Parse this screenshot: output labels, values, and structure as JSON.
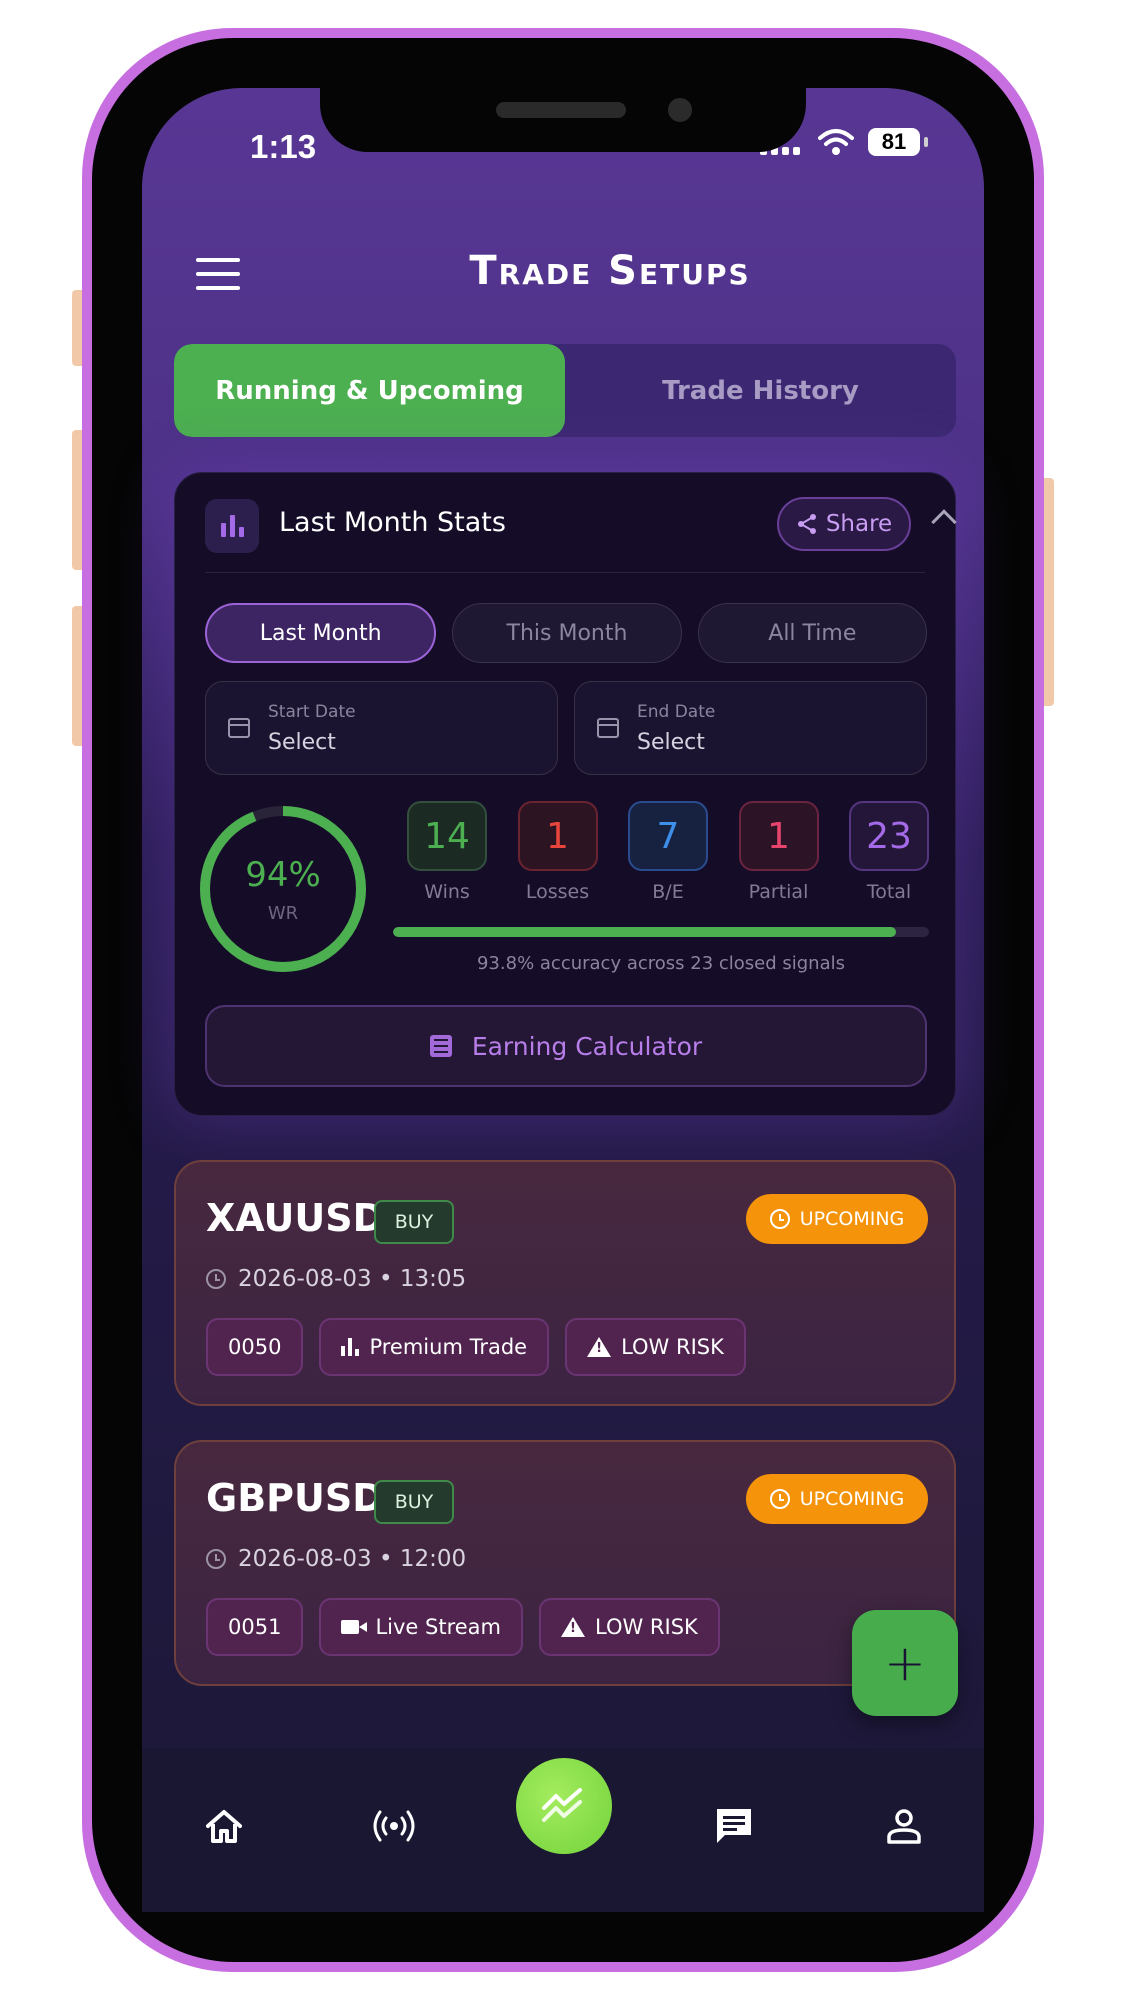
{
  "status_bar": {
    "time": "1:13",
    "battery": "81"
  },
  "header": {
    "title": "Trade Setups"
  },
  "tabs": [
    {
      "label": "Running & Upcoming",
      "active": true
    },
    {
      "label": "Trade History",
      "active": false
    }
  ],
  "stats": {
    "title": "Last Month Stats",
    "share_label": "Share",
    "periods": [
      {
        "label": "Last Month",
        "active": true
      },
      {
        "label": "This Month",
        "active": false
      },
      {
        "label": "All Time",
        "active": false
      }
    ],
    "start_date": {
      "label": "Start Date",
      "value": "Select"
    },
    "end_date": {
      "label": "End Date",
      "value": "Select"
    },
    "win_rate": {
      "value": "94%",
      "label": "WR",
      "fraction": 0.94
    },
    "counts": [
      {
        "value": "14",
        "label": "Wins",
        "color": "#4caf50",
        "bg": "#1c2a24",
        "border": "#34503d"
      },
      {
        "value": "1",
        "label": "Losses",
        "color": "#e8453c",
        "bg": "#2c1422",
        "border": "#6a2430"
      },
      {
        "value": "7",
        "label": "B/E",
        "color": "#3d8fea",
        "bg": "#16223f",
        "border": "#2a4c8e"
      },
      {
        "value": "1",
        "label": "Partial",
        "color": "#e8456e",
        "bg": "#2c1426",
        "border": "#6a2440"
      },
      {
        "value": "23",
        "label": "Total",
        "color": "#a46ae8",
        "bg": "#241638",
        "border": "#55357f"
      }
    ],
    "accuracy": {
      "fraction": 0.938,
      "text": "93.8% accuracy across 23 closed signals"
    },
    "calculator_label": "Earning Calculator"
  },
  "trades": [
    {
      "pair": "XAUUSD",
      "side": "BUY",
      "status": "UPCOMING",
      "datetime": "2026-08-03 • 13:05",
      "tags": [
        {
          "label": "0050",
          "icon": ""
        },
        {
          "label": "Premium Trade",
          "icon": "bar-chart-icon"
        },
        {
          "label": "LOW RISK",
          "icon": "warning-icon"
        }
      ]
    },
    {
      "pair": "GBPUSD",
      "side": "BUY",
      "status": "UPCOMING",
      "datetime": "2026-08-03 • 12:00",
      "tags": [
        {
          "label": "0051",
          "icon": ""
        },
        {
          "label": "Live Stream",
          "icon": "video-icon"
        },
        {
          "label": "LOW RISK",
          "icon": "warning-icon"
        }
      ]
    }
  ],
  "fab": {
    "label": "+"
  },
  "bottom_nav": [
    {
      "icon": "home-icon"
    },
    {
      "icon": "broadcast-icon"
    },
    {
      "icon": "signals-icon",
      "active": true
    },
    {
      "icon": "chat-icon"
    },
    {
      "icon": "profile-icon"
    }
  ],
  "colors": {
    "accent_green": "#4caf50",
    "upcoming_orange": "#f5940a",
    "purple_accent": "#a46ae8"
  }
}
